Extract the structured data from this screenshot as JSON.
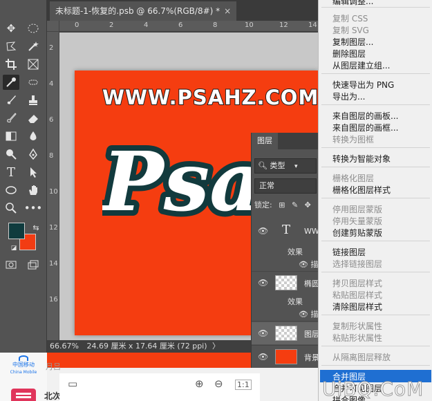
{
  "document_tab": {
    "title": "未标题-1-恢复的.psb @ 66.7%(RGB/8#) *",
    "close": "×"
  },
  "ruler": {
    "h_ticks": [
      "0",
      "2",
      "4",
      "6",
      "8",
      "10",
      "12",
      "14"
    ],
    "v_ticks": [
      "2",
      "4",
      "6",
      "8",
      "10",
      "12",
      "14",
      "16"
    ]
  },
  "canvas": {
    "site_text": "WWW.PSAHZ.COM",
    "logo_text": "Psa",
    "bg_color": "#f53d10",
    "fg_color": "#0f3b3e",
    "bg_swatch_color": "#f23c13"
  },
  "status": {
    "zoom": "66.67%",
    "doc_size": "24.69 厘米 x 17.64 厘米 (72 ppi)",
    "arrow": "〉"
  },
  "bottom": {
    "logo_line1": "中国移动",
    "logo_line2": "China Mobile",
    "date": "月吕",
    "north": "北次"
  },
  "layers": {
    "tab": "图层",
    "filter": "类型",
    "blend": "正常",
    "lock_label": "锁定:",
    "items": [
      {
        "name": "WW",
        "type": "text",
        "sub": [
          "效果",
          "描"
        ]
      },
      {
        "name": "椭圆",
        "type": "shape",
        "sub": [
          "效果",
          "描"
        ]
      },
      {
        "name": "图层",
        "type": "pixel",
        "sub": []
      },
      {
        "name": "背景",
        "type": "background",
        "sub": []
      }
    ]
  },
  "menu": {
    "items": [
      {
        "label": "编辑调整...",
        "enabled": true
      },
      {
        "label": "复制 CSS",
        "enabled": false
      },
      {
        "label": "复制 SVG",
        "enabled": false
      },
      {
        "label": "复制图层...",
        "enabled": true
      },
      {
        "label": "删除图层",
        "enabled": true
      },
      {
        "label": "从图层建立组...",
        "enabled": true
      },
      {
        "label": "快速导出为 PNG",
        "enabled": true
      },
      {
        "label": "导出为...",
        "enabled": true
      },
      {
        "label": "来自图层的画板...",
        "enabled": true
      },
      {
        "label": "来自图层的画框...",
        "enabled": true
      },
      {
        "label": "转换为图框",
        "enabled": false
      },
      {
        "label": "转换为智能对象",
        "enabled": true
      },
      {
        "label": "栅格化图层",
        "enabled": false
      },
      {
        "label": "栅格化图层样式",
        "enabled": true
      },
      {
        "label": "停用图层蒙版",
        "enabled": false
      },
      {
        "label": "停用矢量蒙版",
        "enabled": false
      },
      {
        "label": "创建剪贴蒙版",
        "enabled": true
      },
      {
        "label": "链接图层",
        "enabled": true
      },
      {
        "label": "选择链接图层",
        "enabled": false
      },
      {
        "label": "拷贝图层样式",
        "enabled": false
      },
      {
        "label": "粘贴图层样式",
        "enabled": false
      },
      {
        "label": "清除图层样式",
        "enabled": true
      },
      {
        "label": "复制形状属性",
        "enabled": false
      },
      {
        "label": "粘贴形状属性",
        "enabled": false
      },
      {
        "label": "从隔离图层释放",
        "enabled": false
      },
      {
        "label": "合并图层",
        "enabled": true,
        "highlighted": true
      },
      {
        "label": "合并可见图层",
        "enabled": true
      },
      {
        "label": "拼合图像",
        "enabled": true
      }
    ]
  },
  "watermark": "UiBQ.CoM"
}
